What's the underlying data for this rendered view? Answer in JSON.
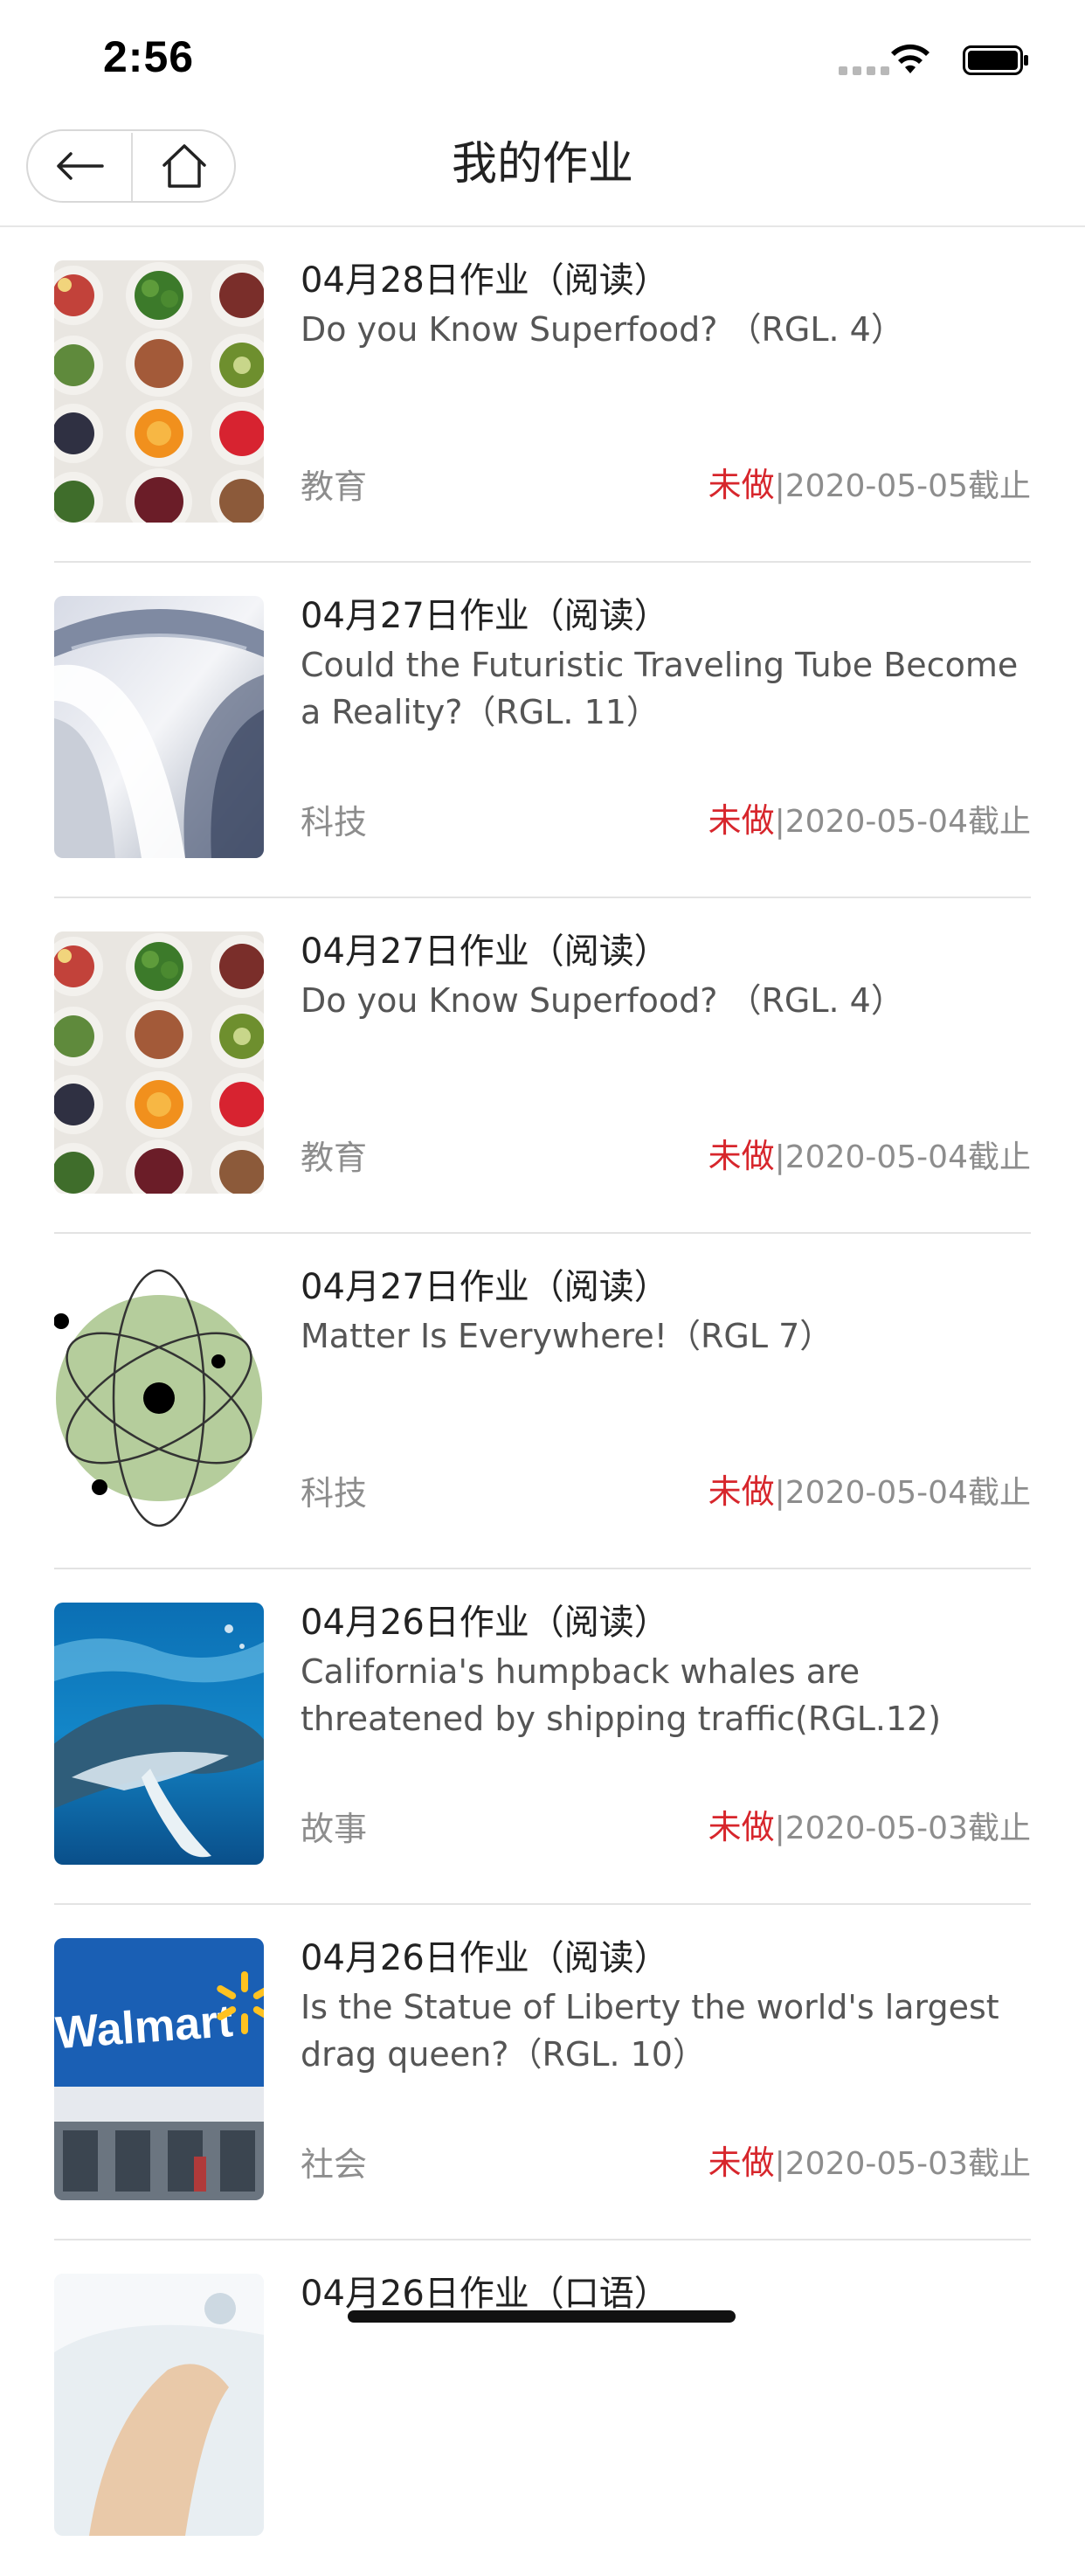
{
  "status_bar": {
    "time": "2:56"
  },
  "nav": {
    "title": "我的作业"
  },
  "assignments": [
    {
      "date": "04月28日作业（阅读）",
      "title": "Do you Know Superfood? （RGL. 4）",
      "category": "教育",
      "status": "未做",
      "deadline": "|2020-05-05截止",
      "thumb": "superfood-icon"
    },
    {
      "date": "04月27日作业（阅读）",
      "title": "Could the Futuristic Traveling Tube Become a Reality?（RGL. 11）",
      "category": "科技",
      "status": "未做",
      "deadline": "|2020-05-04截止",
      "thumb": "tube-icon"
    },
    {
      "date": "04月27日作业（阅读）",
      "title": "Do you Know Superfood? （RGL. 4）",
      "category": "教育",
      "status": "未做",
      "deadline": "|2020-05-04截止",
      "thumb": "superfood-icon"
    },
    {
      "date": "04月27日作业（阅读）",
      "title": "Matter Is Everywhere!（RGL 7）",
      "category": "科技",
      "status": "未做",
      "deadline": "|2020-05-04截止",
      "thumb": "atom-icon"
    },
    {
      "date": "04月26日作业（阅读）",
      "title": "California's humpback whales are threatened by shipping traffic(RGL.12)",
      "category": "故事",
      "status": "未做",
      "deadline": "|2020-05-03截止",
      "thumb": "whale-icon"
    },
    {
      "date": "04月26日作业（阅读）",
      "title": "Is the Statue of Liberty the world's largest drag queen?（RGL. 10）",
      "category": "社会",
      "status": "未做",
      "deadline": "|2020-05-03截止",
      "thumb": "walmart-icon",
      "thumb_text": "Walmart"
    },
    {
      "date": "04月26日作业（口语）",
      "title": "",
      "category": "",
      "status": "",
      "deadline": "",
      "thumb": "hand-icon"
    }
  ],
  "colors": {
    "status_red": "#d7262c",
    "muted": "#8d8d8d"
  }
}
